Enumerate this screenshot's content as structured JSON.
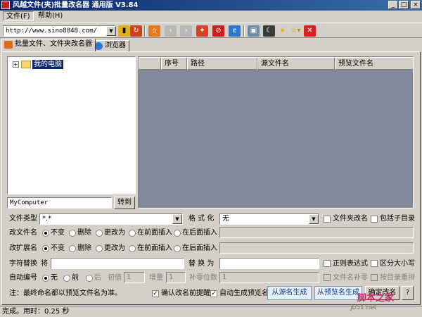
{
  "window": {
    "title": "风越文件(夹)批量改名器 通用版 V3.84",
    "min_label": "_",
    "max_label": "□",
    "close_label": "×"
  },
  "menu": [
    "文件(F)",
    "帮助(H)"
  ],
  "toolbar": {
    "url": "http://www.sino8848.com/",
    "icons": [
      "pause-icon",
      "refresh-icon",
      "home-icon",
      "back-icon",
      "forward-icon",
      "tools-icon",
      "stop-icon",
      "ie-icon",
      "window-icon",
      "moon-icon",
      "star-icon",
      "add-favorite-icon",
      "close-red-icon"
    ]
  },
  "tabs": [
    {
      "label": "批量文件、文件夹改名器",
      "icon": "rename-icon"
    },
    {
      "label": "浏览器",
      "icon": "globe-icon"
    }
  ],
  "tree": {
    "root_label": "我的电脑",
    "expand_glyph": "+"
  },
  "path": {
    "value": "MyComputer",
    "go_label": "转到"
  },
  "grid": {
    "columns": [
      "",
      "序号",
      "路径",
      "源文件名",
      "预览文件名"
    ]
  },
  "form": {
    "file_type_label": "文件类型",
    "file_type_value": "*.*",
    "format_label": "格 式 化",
    "format_value": "无",
    "folder_rename_label": "文件夹改名",
    "include_sub_label": "包括子目录",
    "rename_file_label": "改文件名",
    "rename_ext_label": "改扩展名",
    "radio_options": [
      "不变",
      "删除",
      "更改为",
      "在前面插入",
      "在后面插入"
    ],
    "replace_label": "字符替换",
    "replace_from_label": "将",
    "replace_to_label": "替 换 为",
    "regex_label": "正则表达式",
    "case_label": "区分大小写",
    "autonum_label": "自动编号",
    "autonum_options": [
      "无",
      "前",
      "后"
    ],
    "start_label": "初值",
    "start_value": "1",
    "step_label": "增量",
    "step_value": "1",
    "pad_label": "补零位数",
    "pad_value": "1",
    "file_pad_label": "文件名补零",
    "by_dir_label": "按目录重排",
    "note": "注：最终命名都以预览文件名为准。",
    "confirm_label": "确认改名前提醒",
    "auto_preview_label": "自动生成预览名",
    "gen_from_source_label": "从源名生成",
    "gen_from_preview_label": "从预览名生成",
    "confirm_rename_label": "确定改名",
    "help_label": "?"
  },
  "status": "完成。用时：0.25 秒",
  "watermark": "脚本之家",
  "watermark2": "jb51.net",
  "colors": {
    "title": "#0a246a",
    "grid_bg": "#808a9a",
    "selection": "#0a246a"
  }
}
